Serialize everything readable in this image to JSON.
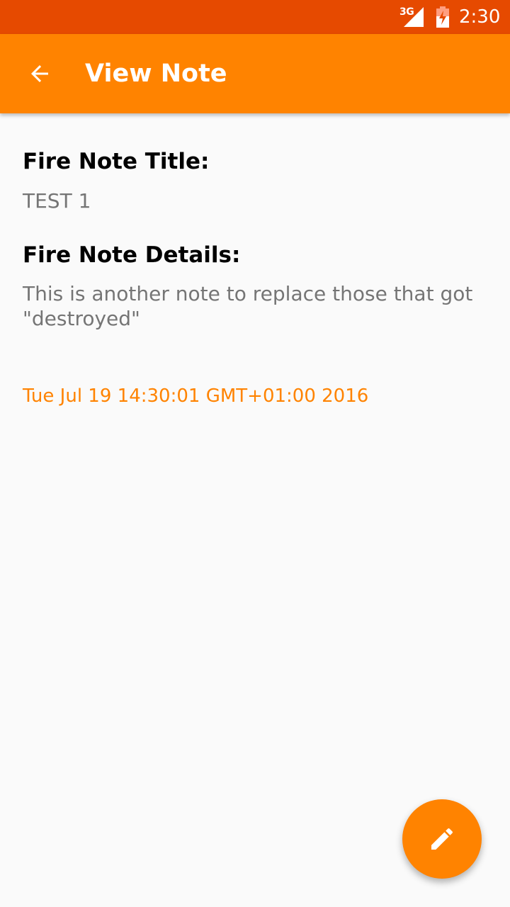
{
  "status_bar": {
    "network": "3G",
    "time": "2:30",
    "signal_icon": "signal-icon",
    "battery_icon": "battery-charging-icon"
  },
  "app_bar": {
    "title": "View Note",
    "back_icon": "arrow-back-icon",
    "color": "#ff8300"
  },
  "note": {
    "title_label": "Fire Note Title:",
    "title_value": "TEST 1",
    "details_label": "Fire Note Details:",
    "details_value": "This is another note to replace those that got \"destroyed\"",
    "timestamp": "Tue Jul 19 14:30:01 GMT+01:00 2016"
  },
  "fab": {
    "icon": "edit-icon",
    "color": "#ff8300"
  },
  "colors": {
    "status_bar": "#e64a00",
    "accent": "#ff8300",
    "background": "#fafafa"
  }
}
